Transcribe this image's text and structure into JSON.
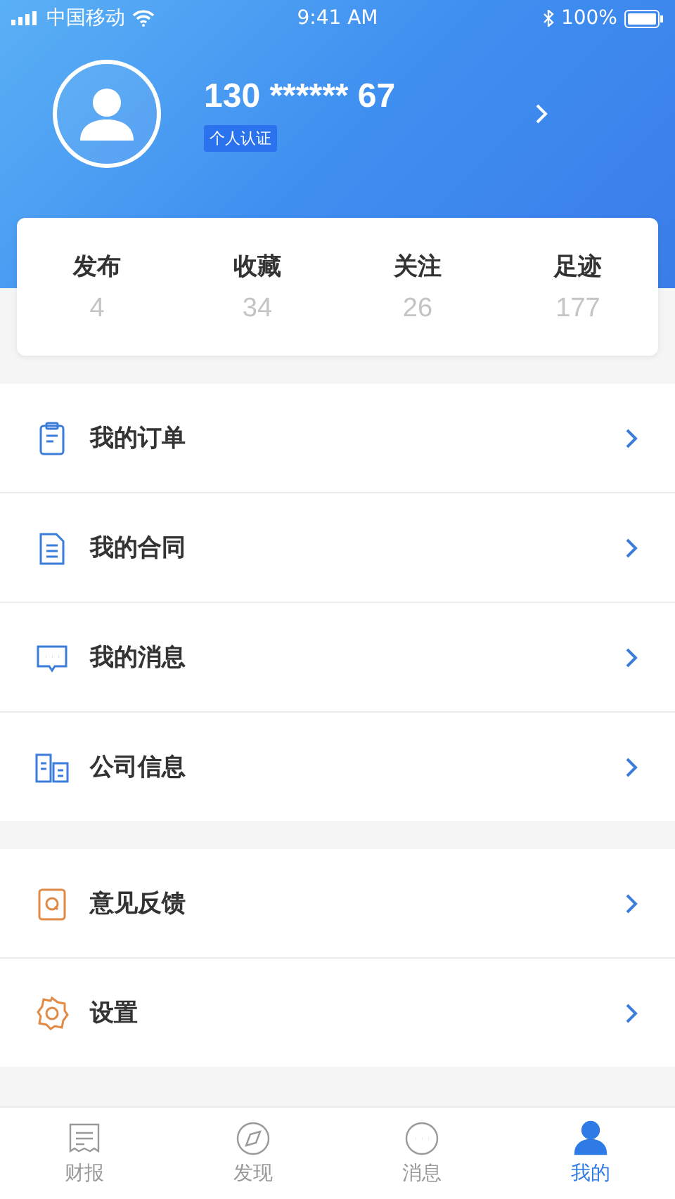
{
  "status_bar": {
    "carrier": "中国移动",
    "time": "9:41 AM",
    "battery": "100%"
  },
  "profile": {
    "phone": "130 ****** 67",
    "badge": "个人认证"
  },
  "stats": [
    {
      "label": "发布",
      "value": "4"
    },
    {
      "label": "收藏",
      "value": "34"
    },
    {
      "label": "关注",
      "value": "26"
    },
    {
      "label": "足迹",
      "value": "177"
    }
  ],
  "menu_groups": [
    [
      {
        "label": "我的订单",
        "kind": "clipboard",
        "color": "#3b7dd8"
      },
      {
        "label": "我的合同",
        "kind": "document",
        "color": "#3b7dd8"
      },
      {
        "label": "我的消息",
        "kind": "message",
        "color": "#3b7dd8"
      },
      {
        "label": "公司信息",
        "kind": "company",
        "color": "#3b7dd8"
      }
    ],
    [
      {
        "label": "意见反馈",
        "kind": "feedback",
        "color": "#e08a45"
      },
      {
        "label": "设置",
        "kind": "settings",
        "color": "#e08a45"
      }
    ]
  ],
  "tab_bar": [
    {
      "label": "财报",
      "kind": "report",
      "selected": false
    },
    {
      "label": "发现",
      "kind": "discover",
      "selected": false
    },
    {
      "label": "消息",
      "kind": "message",
      "selected": false
    },
    {
      "label": "我的",
      "kind": "me",
      "selected": true
    }
  ]
}
